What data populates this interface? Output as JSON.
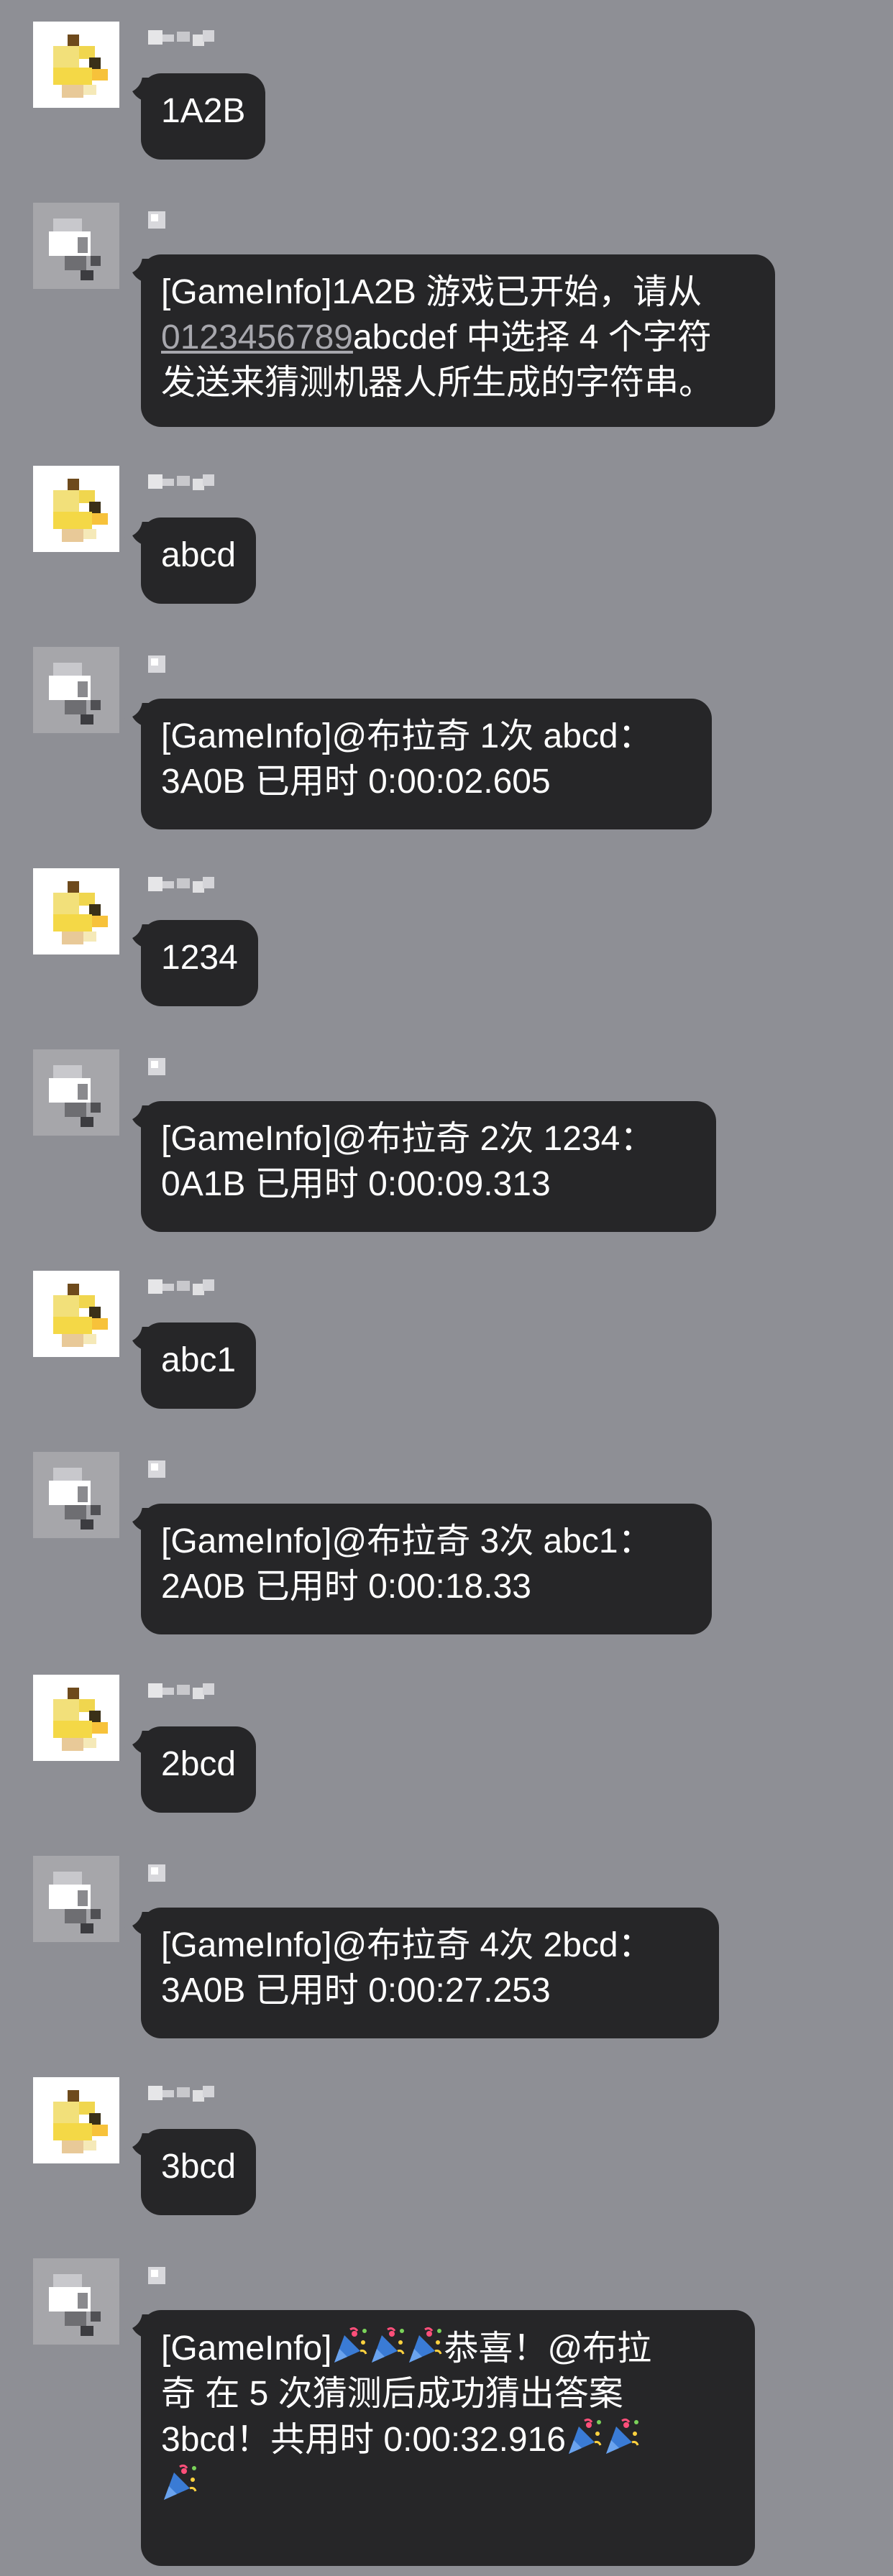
{
  "chat": {
    "messages": [
      {
        "sender": "user",
        "avatar_icon": "duck-avatar-icon",
        "lines": [
          "1A2B"
        ]
      },
      {
        "sender": "bot",
        "avatar_icon": "robot-avatar-icon",
        "lines": [
          "[GameInfo]1A2B 游戏已开始，请从",
          "0123456789abcdef 中选择 4 个字符",
          "发送来猜测机器人所生成的字符串。"
        ]
      },
      {
        "sender": "user",
        "avatar_icon": "duck-avatar-icon",
        "lines": [
          "abcd"
        ]
      },
      {
        "sender": "bot",
        "avatar_icon": "robot-avatar-icon",
        "lines": [
          "[GameInfo]@布拉奇 1次 abcd：",
          "3A0B 已用时 0:00:02.605"
        ]
      },
      {
        "sender": "user",
        "avatar_icon": "duck-avatar-icon",
        "lines": [
          "1234"
        ]
      },
      {
        "sender": "bot",
        "avatar_icon": "robot-avatar-icon",
        "lines": [
          "[GameInfo]@布拉奇 2次 1234：",
          "0A1B 已用时 0:00:09.313"
        ]
      },
      {
        "sender": "user",
        "avatar_icon": "duck-avatar-icon",
        "lines": [
          "abc1"
        ]
      },
      {
        "sender": "bot",
        "avatar_icon": "robot-avatar-icon",
        "lines": [
          "[GameInfo]@布拉奇 3次 abc1：",
          "2A0B 已用时 0:00:18.33"
        ]
      },
      {
        "sender": "user",
        "avatar_icon": "duck-avatar-icon",
        "lines": [
          "2bcd"
        ]
      },
      {
        "sender": "bot",
        "avatar_icon": "robot-avatar-icon",
        "lines": [
          "[GameInfo]@布拉奇 4次 2bcd：",
          "3A0B 已用时 0:00:27.253"
        ]
      },
      {
        "sender": "user",
        "avatar_icon": "duck-avatar-icon",
        "lines": [
          "3bcd"
        ]
      },
      {
        "sender": "bot",
        "avatar_icon": "robot-avatar-icon",
        "lines": [
          "[GameInfo]🎉🎉🎉恭喜！@布拉",
          "奇 在 5 次猜测后成功猜出答案",
          "3bcd！共用时 0:00:32.916🎉🎉",
          "🎉"
        ]
      }
    ],
    "link_text": "0123456789",
    "link_rest": "abcdef 中选择 4 个字符",
    "final_parts": {
      "line1_prefix": "[GameInfo]",
      "line1_suffix": "恭喜！@布拉",
      "line3_prefix": "3bcd！共用时 0:00:32.916"
    },
    "colors": {
      "background": "#8e8f95",
      "bubble": "#262628",
      "text": "#ffffff",
      "link": "#a7a7ad"
    }
  }
}
